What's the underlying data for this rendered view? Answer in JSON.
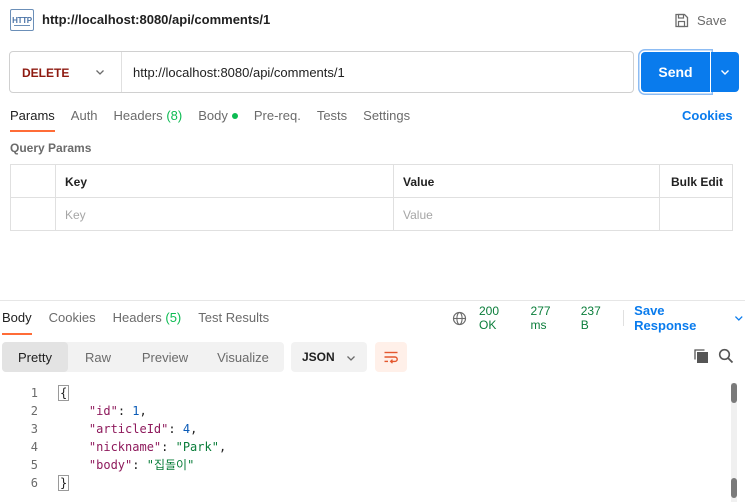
{
  "header": {
    "icon": "http-file-icon",
    "icon_text": "HTTP",
    "title": "http://localhost:8080/api/comments/1",
    "save_label": "Save"
  },
  "request": {
    "method": "DELETE",
    "url": "http://localhost:8080/api/comments/1",
    "send_label": "Send",
    "colors": {
      "method": "#8e1a10",
      "send": "#097bed"
    }
  },
  "request_tabs": [
    {
      "label": "Params",
      "active": true
    },
    {
      "label": "Auth"
    },
    {
      "label": "Headers",
      "count": "(8)"
    },
    {
      "label": "Body",
      "indicator": "green-dot"
    },
    {
      "label": "Pre-req."
    },
    {
      "label": "Tests"
    },
    {
      "label": "Settings"
    }
  ],
  "cookies_label": "Cookies",
  "query_params": {
    "title": "Query Params",
    "headers": {
      "key": "Key",
      "value": "Value",
      "bulk_edit": "Bulk Edit"
    },
    "placeholders": {
      "key": "Key",
      "value": "Value"
    }
  },
  "response_tabs": [
    {
      "label": "Body",
      "active": true
    },
    {
      "label": "Cookies"
    },
    {
      "label": "Headers",
      "count": "(5)"
    },
    {
      "label": "Test Results"
    }
  ],
  "response_meta": {
    "status": "200 OK",
    "time": "277 ms",
    "size": "237 B",
    "save_response": "Save Response"
  },
  "view_modes": [
    "Pretty",
    "Raw",
    "Preview",
    "Visualize"
  ],
  "active_view": "Pretty",
  "format": "JSON",
  "response_body": [
    {
      "line": "1",
      "text": "{"
    },
    {
      "line": "2",
      "key": "\"id\"",
      "value": "1",
      "type": "number"
    },
    {
      "line": "3",
      "key": "\"articleId\"",
      "value": "4",
      "type": "number"
    },
    {
      "line": "4",
      "key": "\"nickname\"",
      "value": "\"Park\"",
      "type": "string"
    },
    {
      "line": "5",
      "key": "\"body\"",
      "value": "\"집돌이\"",
      "type": "string"
    },
    {
      "line": "6",
      "text": "}"
    }
  ],
  "accent_color": "#ff6c37"
}
